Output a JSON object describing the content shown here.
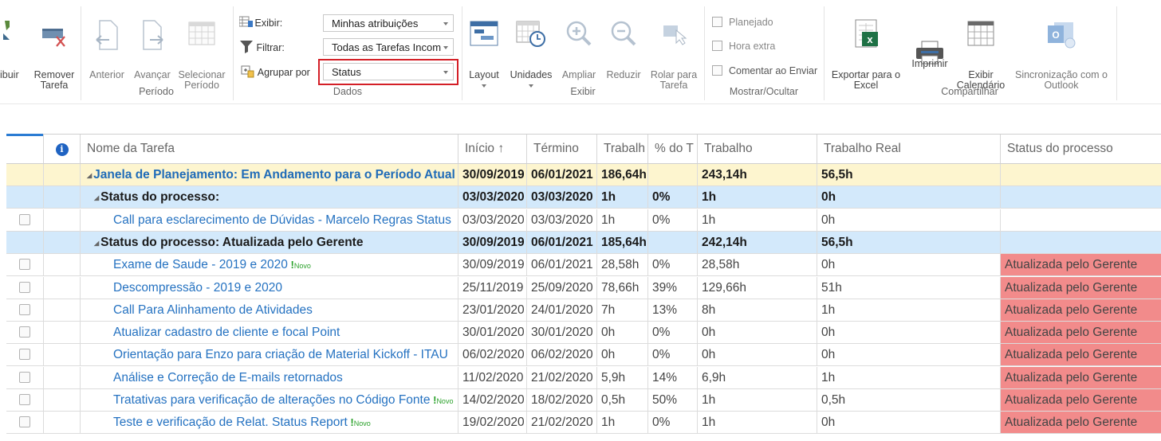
{
  "ribbon": {
    "buttons": {
      "atribuir": "ibuir",
      "remover": "Remover\nTarefa",
      "anterior": "Anterior",
      "avancar": "Avançar",
      "selecionar": "Selecionar\nPeríodo",
      "layout": "Layout",
      "unidades": "Unidades",
      "ampliar": "Ampliar",
      "reduzir": "Reduzir",
      "rolar": "Rolar para\nTarefa",
      "exportar": "Exportar para o\nExcel",
      "imprimir": "Imprimir",
      "calendario": "Exibir\nCalendário",
      "sincronizacao": "Sincronização com o\nOutlook"
    },
    "dados": {
      "exibir_label": "Exibir:",
      "filtrar_label": "Filtrar:",
      "agrupar_label": "Agrupar por",
      "exibir_value": "Minhas atribuições",
      "filtrar_value": "Todas as Tarefas Incom",
      "agrupar_value": "Status"
    },
    "checks": {
      "planejado": "Planejado",
      "hora_extra": "Hora extra",
      "comentar": "Comentar ao Enviar"
    },
    "groups": {
      "periodo": "Período",
      "dados": "Dados",
      "exibir": "Exibir",
      "mostrar": "Mostrar/Ocultar",
      "compartilhar": "Compartilhar"
    }
  },
  "grid": {
    "headers": {
      "info": "i",
      "nome": "Nome da Tarefa",
      "inicio": "Início ↑",
      "termino": "Término",
      "trab": "Trabalh",
      "pct": "% do T",
      "trabalho": "Trabalho",
      "real": "Trabalho Real",
      "status": "Status do processo"
    },
    "rows": [
      {
        "kind": "sum1",
        "nome": "Janela de Planejamento: Em Andamento para o Período Atual",
        "inicio": "30/09/2019",
        "termino": "06/01/2021",
        "trab": "186,64h",
        "pct": "",
        "trabalho": "243,14h",
        "real": "56,5h",
        "status": ""
      },
      {
        "kind": "sum2",
        "nome": "Status do processo:",
        "inicio": "03/03/2020",
        "termino": "03/03/2020",
        "trab": "1h",
        "pct": "0%",
        "trabalho": "1h",
        "real": "0h",
        "status": ""
      },
      {
        "kind": "task",
        "nome": "Call para esclarecimento de Dúvidas - Marcelo Regras Status",
        "inicio": "03/03/2020",
        "termino": "03/03/2020",
        "trab": "1h",
        "pct": "0%",
        "trabalho": "1h",
        "real": "0h",
        "status": "",
        "badge": ""
      },
      {
        "kind": "sum2",
        "nome": "Status do processo: Atualizada pelo Gerente",
        "inicio": "30/09/2019",
        "termino": "06/01/2021",
        "trab": "185,64h",
        "pct": "",
        "trabalho": "242,14h",
        "real": "56,5h",
        "status": ""
      },
      {
        "kind": "task",
        "nome": "Exame de Saude - 2019 e 2020",
        "inicio": "30/09/2019",
        "termino": "06/01/2021",
        "trab": "28,58h",
        "pct": "0%",
        "trabalho": "28,58h",
        "real": "0h",
        "status": "Atualizada pelo Gerente",
        "badge": "Novo"
      },
      {
        "kind": "task",
        "nome": "Descompressão - 2019 e 2020",
        "inicio": "25/11/2019",
        "termino": "25/09/2020",
        "trab": "78,66h",
        "pct": "39%",
        "trabalho": "129,66h",
        "real": "51h",
        "status": "Atualizada pelo Gerente",
        "badge": ""
      },
      {
        "kind": "task",
        "nome": "Call Para Alinhamento de Atividades",
        "inicio": "23/01/2020",
        "termino": "24/01/2020",
        "trab": "7h",
        "pct": "13%",
        "trabalho": "8h",
        "real": "1h",
        "status": "Atualizada pelo Gerente",
        "badge": ""
      },
      {
        "kind": "task",
        "nome": "Atualizar cadastro de cliente e focal Point",
        "inicio": "30/01/2020",
        "termino": "30/01/2020",
        "trab": "0h",
        "pct": "0%",
        "trabalho": "0h",
        "real": "0h",
        "status": "Atualizada pelo Gerente",
        "badge": ""
      },
      {
        "kind": "task",
        "nome": "Orientação para Enzo para criação de Material Kickoff - ITAU",
        "inicio": "06/02/2020",
        "termino": "06/02/2020",
        "trab": "0h",
        "pct": "0%",
        "trabalho": "0h",
        "real": "0h",
        "status": "Atualizada pelo Gerente",
        "badge": ""
      },
      {
        "kind": "task",
        "nome": "Análise e Correção de E-mails retornados",
        "inicio": "11/02/2020",
        "termino": "21/02/2020",
        "trab": "5,9h",
        "pct": "14%",
        "trabalho": "6,9h",
        "real": "1h",
        "status": "Atualizada pelo Gerente",
        "badge": ""
      },
      {
        "kind": "task",
        "nome": "Tratativas para verificação de alterações no Código Fonte",
        "inicio": "14/02/2020",
        "termino": "18/02/2020",
        "trab": "0,5h",
        "pct": "50%",
        "trabalho": "1h",
        "real": "0,5h",
        "status": "Atualizada pelo Gerente",
        "badge": "Novo"
      },
      {
        "kind": "task",
        "nome": "Teste e verificação de Relat. Status Report",
        "inicio": "19/02/2020",
        "termino": "21/02/2020",
        "trab": "1h",
        "pct": "0%",
        "trabalho": "1h",
        "real": "0h",
        "status": "Atualizada pelo Gerente",
        "badge": "Novo"
      }
    ]
  }
}
